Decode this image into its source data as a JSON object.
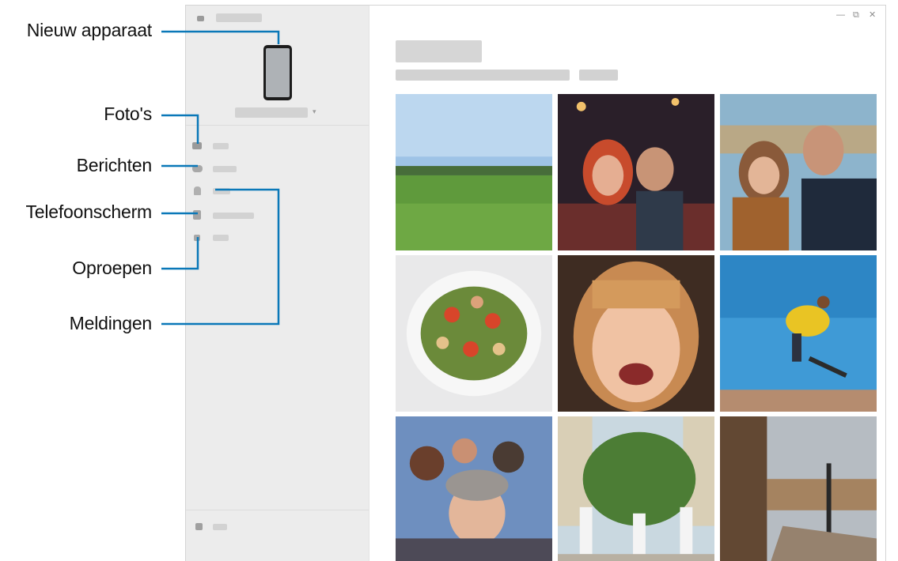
{
  "callouts": {
    "new_device": "Nieuw apparaat",
    "photos": "Foto's",
    "messages": "Berichten",
    "phone_screen": "Telefoonscherm",
    "calls": "Oproepen",
    "notifications": "Meldingen"
  },
  "colors": {
    "sidebar_bg": "#ececec",
    "placeholder": "#d2d2d2",
    "callout_line": "#0a78b8"
  },
  "window_controls": {
    "minimize_icon": "minimize-icon",
    "restore_icon": "restore-icon",
    "close_icon": "close-icon"
  },
  "photos": [
    {
      "subject": "grass-field"
    },
    {
      "subject": "couple-selfie-night"
    },
    {
      "subject": "couple-selfie-day"
    },
    {
      "subject": "salad-plate"
    },
    {
      "subject": "smiling-girl"
    },
    {
      "subject": "skateboard-jump"
    },
    {
      "subject": "group-selfie"
    },
    {
      "subject": "cafe-tree"
    },
    {
      "subject": "city-street"
    }
  ]
}
